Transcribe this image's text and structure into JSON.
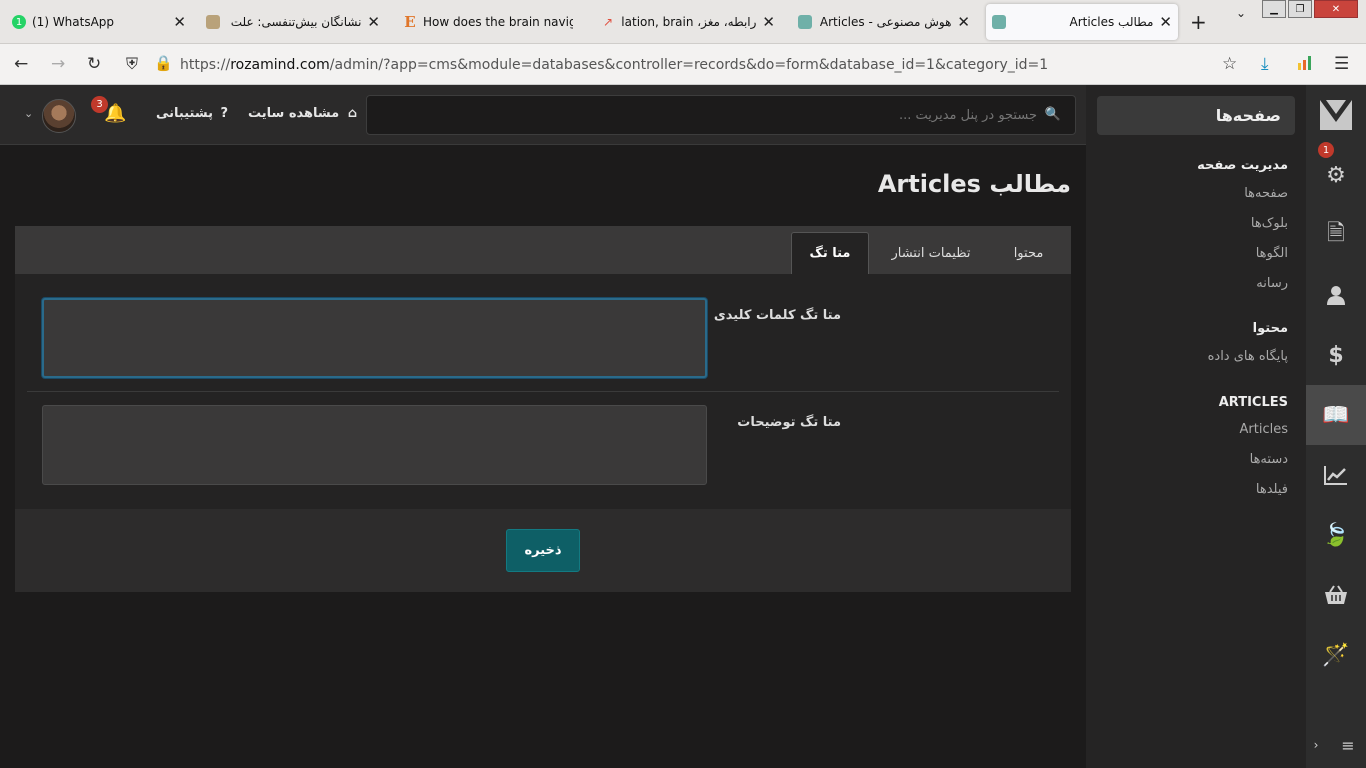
{
  "browser": {
    "tabs": [
      {
        "title": "(1) WhatsApp",
        "favicon": "whatsapp-icon",
        "badge": "1"
      },
      {
        "title": "نشانگان بیش‌تنفسی: علت اصلی",
        "favicon": "site-icon"
      },
      {
        "title": "How does the brain navigate",
        "favicon": "E"
      },
      {
        "title": "رابطه، مغز، relation, brain",
        "favicon": "trends-icon"
      },
      {
        "title": "هوش مصنوعی - Articles - انشا",
        "favicon": "site-icon"
      },
      {
        "title": "مطالب Articles",
        "favicon": "site-icon",
        "active": true
      }
    ],
    "url_prefix": "https://",
    "url_host": "rozamind.com",
    "url_path": "/admin/?app=cms&module=databases&controller=records&do=form&database_id=1&category_id=1"
  },
  "header": {
    "search_placeholder": "جستجو در پنل مدیریت ...",
    "view_site": "مشاهده سایت",
    "support": "پشتیبانی",
    "notification_count": "3"
  },
  "rail": {
    "settings_badge": "1"
  },
  "subnav": {
    "title": "صفحه‌ها",
    "sections": [
      {
        "heading": "مدیریت صفحه",
        "items": [
          "صفحه‌ها",
          "بلوک‌ها",
          "الگوها",
          "رسانه"
        ]
      },
      {
        "heading": "محتوا",
        "items": [
          "پایگاه های داده"
        ]
      },
      {
        "heading": "ARTICLES",
        "items": [
          "Articles",
          "دسته‌ها",
          "فیلدها"
        ]
      }
    ]
  },
  "main": {
    "title": "مطالب Articles",
    "tabs": [
      "محتوا",
      "تظیمات انتشار",
      "متا تگ"
    ],
    "active_tab": "متا تگ",
    "fields": {
      "keywords_label": "متا تگ کلمات کلیدی",
      "keywords_value": "",
      "description_label": "متا تگ توضیحات",
      "description_value": ""
    },
    "save_label": "ذخیره"
  }
}
